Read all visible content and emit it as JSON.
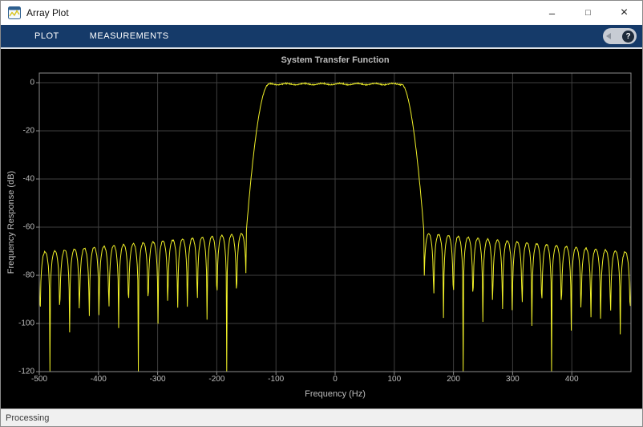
{
  "window": {
    "title": "Array Plot",
    "controls": [
      {
        "name": "minimize",
        "glyph": "–"
      },
      {
        "name": "maximize",
        "glyph": "□"
      },
      {
        "name": "close",
        "glyph": "×"
      }
    ]
  },
  "toolstrip": {
    "tabs": [
      {
        "label": "PLOT"
      },
      {
        "label": "MEASUREMENTS"
      }
    ],
    "help_label": "?"
  },
  "statusbar": {
    "text": "Processing"
  },
  "ui_colors": {
    "titlebar_bg": "#ffffff",
    "toolstrip_bg": "#153a69",
    "statusbar_bg": "#f0f0f0",
    "plot_bg": "#000000",
    "chart_text": "#bdbdbd"
  },
  "chart_data": {
    "type": "line",
    "title": "System Transfer Function",
    "xlabel": "Frequency (Hz)",
    "ylabel": "Frequency Response (dB)",
    "xlim": [
      -500,
      500
    ],
    "ylim": [
      -120,
      4
    ],
    "xticks": [
      -500,
      -400,
      -300,
      -200,
      -100,
      0,
      100,
      200,
      300,
      400
    ],
    "yticks": [
      0,
      -20,
      -40,
      -60,
      -80,
      -100,
      -120
    ],
    "grid": true,
    "axes_style": {
      "background": "#000000",
      "grid_color": "#3f3f3f",
      "border_color": "#8c8c8c",
      "tick_color": "#8c8c8c",
      "text_color": "#bdbdbd"
    },
    "series": [
      {
        "name": "System Transfer Function",
        "line_color": "#f1f128",
        "model": {
          "kind": "lowpass_fir_magnitude_db",
          "passband_edge_hz": 112,
          "passband_gain_db": -0.6,
          "passband_ripple_db": 0.7,
          "stopband_start_hz": 150,
          "first_sidelobe_db": -62.5,
          "far_sidelobe_db": -70.5,
          "sidelobe_spacing_hz": 16.6,
          "deepest_null_db": -120,
          "sample_step_hz": 0.9
        }
      }
    ]
  }
}
